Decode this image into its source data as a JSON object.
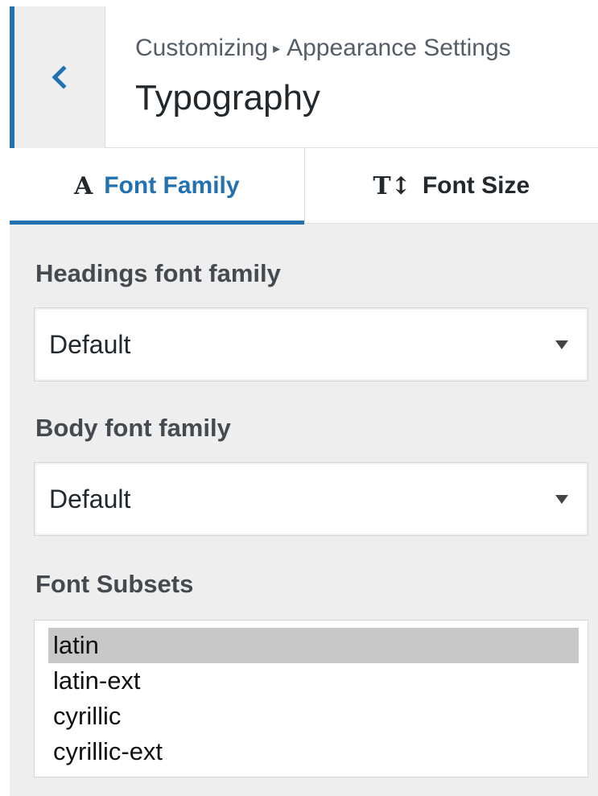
{
  "header": {
    "back_icon": "chevron-left-icon",
    "breadcrumb_root": "Customizing",
    "breadcrumb_separator": "▸",
    "breadcrumb_section": "Appearance Settings",
    "title": "Typography"
  },
  "tabs": [
    {
      "icon": "A",
      "icon_name": "font-family-icon",
      "label": "Font Family",
      "active": true
    },
    {
      "icon": "T↕",
      "icon_name": "font-size-icon",
      "label": "Font Size",
      "active": false
    }
  ],
  "fields": {
    "headings": {
      "label": "Headings font family",
      "value": "Default"
    },
    "body": {
      "label": "Body font family",
      "value": "Default"
    },
    "subsets": {
      "label": "Font Subsets",
      "options": [
        "latin",
        "latin-ext",
        "cyrillic",
        "cyrillic-ext"
      ],
      "selected": "latin"
    }
  },
  "colors": {
    "accent": "#2271b1",
    "panel_bg": "#eeeeee",
    "selected_option_bg": "#c8c8c8"
  }
}
